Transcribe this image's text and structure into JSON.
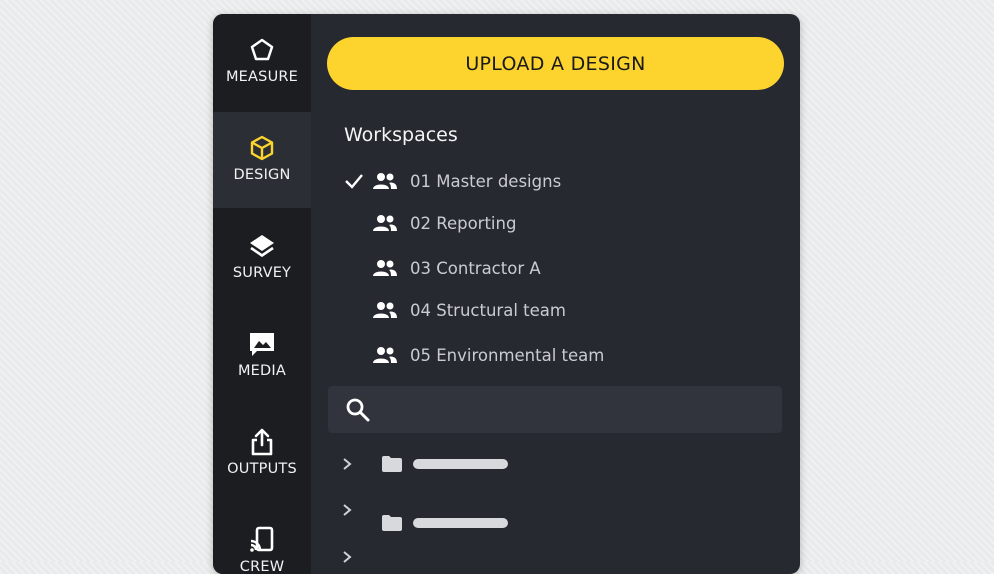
{
  "sidebar": {
    "items": [
      {
        "label": "MEASURE",
        "icon": "pentagon-icon"
      },
      {
        "label": "DESIGN",
        "icon": "cube-icon",
        "active": true
      },
      {
        "label": "SURVEY",
        "icon": "layers-icon"
      },
      {
        "label": "MEDIA",
        "icon": "image-icon"
      },
      {
        "label": "OUTPUTS",
        "icon": "share-icon"
      },
      {
        "label": "CREW",
        "icon": "cast-icon"
      }
    ]
  },
  "main": {
    "upload_label": "UPLOAD A DESIGN",
    "workspaces_title": "Workspaces",
    "workspaces": [
      {
        "name": "01 Master designs",
        "selected": true
      },
      {
        "name": "02 Reporting",
        "selected": false
      },
      {
        "name": "03 Contractor A",
        "selected": false
      },
      {
        "name": "04 Structural team",
        "selected": false
      },
      {
        "name": "05 Environmental team",
        "selected": false
      }
    ],
    "search": {
      "placeholder": "",
      "value": ""
    }
  },
  "colors": {
    "accent": "#fdd32e",
    "panel": "#262930",
    "rail": "#1b1d21",
    "active_rail": "#2b2e35",
    "text_muted": "#c9ccd1"
  }
}
